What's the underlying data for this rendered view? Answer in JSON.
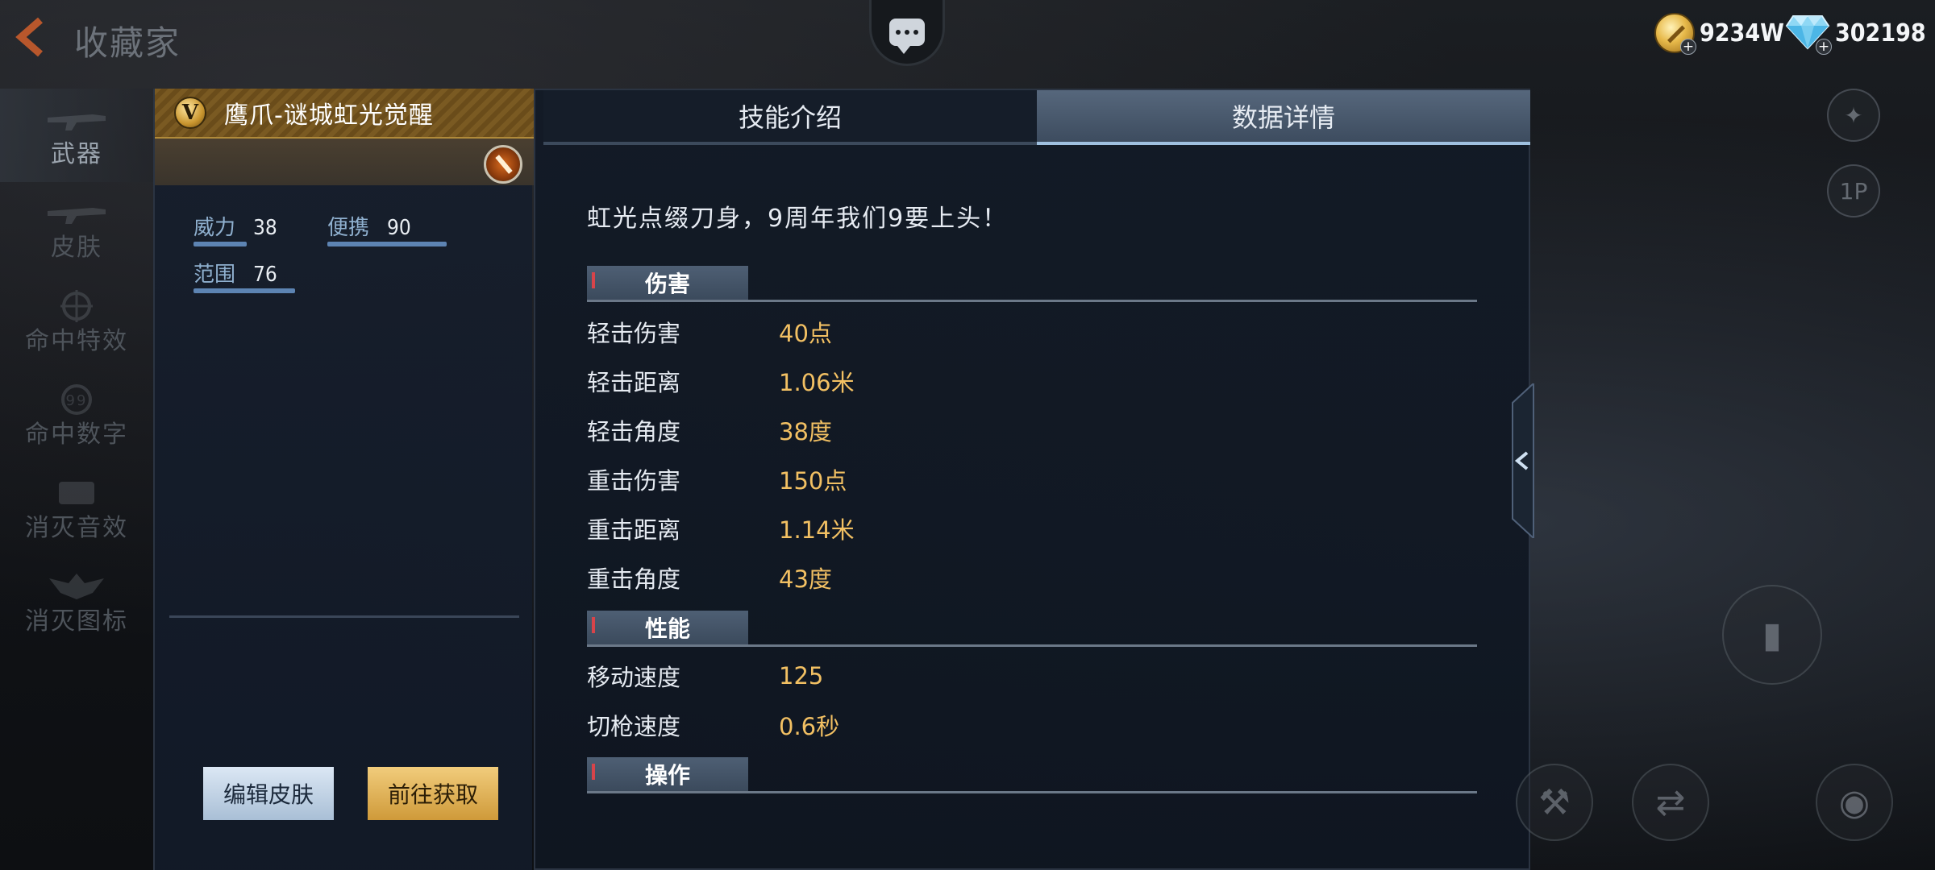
{
  "header": {
    "title": "收藏家",
    "gold_amount": "9234W",
    "diamond_amount": "302198"
  },
  "nav": {
    "items": [
      {
        "label": "武器",
        "active": true
      },
      {
        "label": "皮肤",
        "active": false
      },
      {
        "label": "命中特效",
        "active": false
      },
      {
        "label": "命中数字",
        "active": false
      },
      {
        "label": "消灭音效",
        "active": false
      },
      {
        "label": "消灭图标",
        "active": false
      }
    ]
  },
  "skin": {
    "rank_badge": "V",
    "name": "鹰爪-谜城虹光觉醒",
    "stats": [
      {
        "label": "威力",
        "value": "38"
      },
      {
        "label": "便携",
        "value": "90"
      },
      {
        "label": "范围",
        "value": "76"
      }
    ],
    "edit_button": "编辑皮肤",
    "obtain_button": "前往获取"
  },
  "tabs": [
    {
      "label": "技能介绍",
      "active": false
    },
    {
      "label": "数据详情",
      "active": true
    }
  ],
  "details": {
    "description": "虹光点缀刀身，9周年我们9要上头！",
    "sections": [
      {
        "title": "伤害",
        "rows": [
          {
            "key": "轻击伤害",
            "value": "40点"
          },
          {
            "key": "轻击距离",
            "value": "1.06米"
          },
          {
            "key": "轻击角度",
            "value": "38度"
          },
          {
            "key": "重击伤害",
            "value": "150点"
          },
          {
            "key": "重击距离",
            "value": "1.14米"
          },
          {
            "key": "重击角度",
            "value": "43度"
          }
        ]
      },
      {
        "title": "性能",
        "rows": [
          {
            "key": "移动速度",
            "value": "125"
          },
          {
            "key": "切枪速度",
            "value": "0.6秒"
          }
        ]
      },
      {
        "title": "操作",
        "rows": []
      }
    ]
  },
  "side": {
    "perspective_label": "1P"
  },
  "colors": {
    "accent_gold": "#f2c063",
    "tab_active": "#3d4c5f",
    "stat_bar": "#5d84b3"
  }
}
